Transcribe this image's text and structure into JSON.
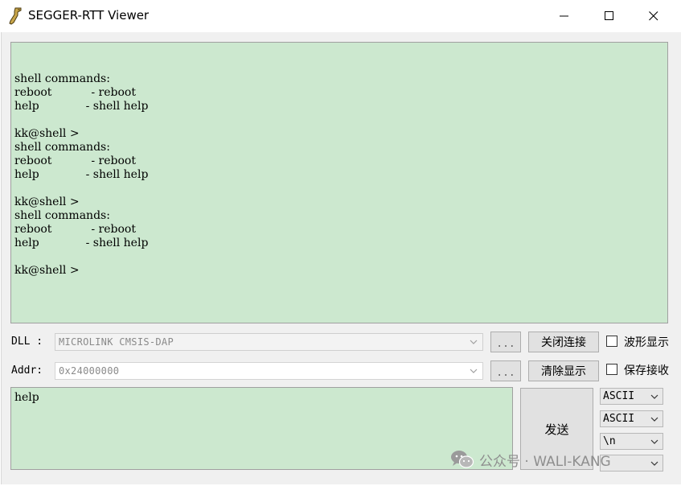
{
  "window": {
    "title": "SEGGER-RTT Viewer"
  },
  "console": {
    "lines": [
      "",
      "shell commands:",
      "reboot           - reboot",
      "help             - shell help",
      "",
      "kk@shell >",
      "shell commands:",
      "reboot           - reboot",
      "help             - shell help",
      "",
      "kk@shell >",
      "shell commands:",
      "reboot           - reboot",
      "help             - shell help",
      "",
      "kk@shell >"
    ]
  },
  "dll": {
    "label": "DLL :",
    "value": "MICROLINK CMSIS-DAP",
    "browse_label": "...",
    "close_button": "关闭连接",
    "checkbox_label": "波形显示"
  },
  "addr": {
    "label": "Addr:",
    "value": "0x24000000",
    "browse_label": "...",
    "clear_button": "清除显示",
    "checkbox_label": "保存接收"
  },
  "input": {
    "value": "help",
    "send_button": "发送"
  },
  "options": {
    "encoding_1": "ASCII",
    "encoding_2": "ASCII",
    "line_ending": "\\n"
  },
  "watermark": {
    "text": "公众号 · WALI-KANG"
  },
  "colors": {
    "console_bg": "#cce8cf",
    "window_bg": "#f0f0f0"
  }
}
